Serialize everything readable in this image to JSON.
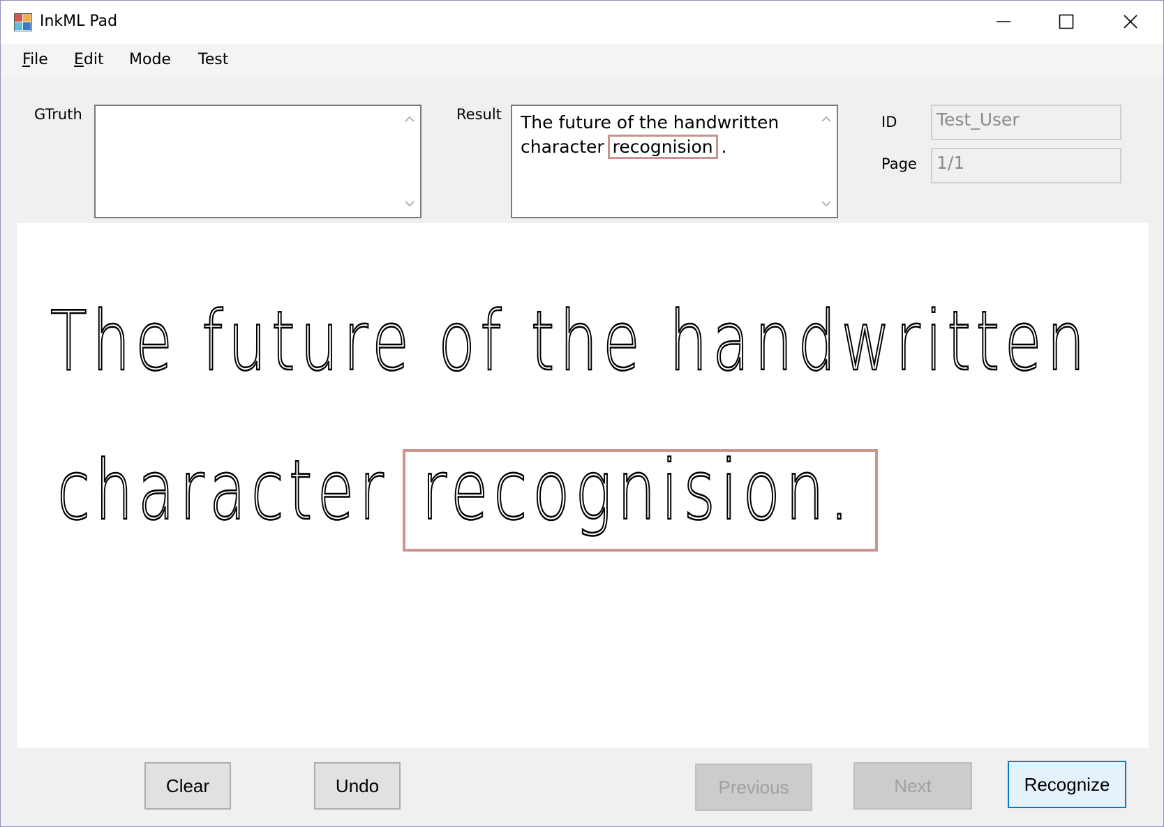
{
  "window": {
    "title": "InkML Pad",
    "controls": {
      "minimize_icon": "minimize-icon",
      "maximize_icon": "maximize-icon",
      "close_icon": "close-icon"
    }
  },
  "menu": {
    "items": [
      {
        "label": "File",
        "mnemonic": "F",
        "rest": "ile"
      },
      {
        "label": "Edit",
        "mnemonic": "E",
        "rest": "dit"
      },
      {
        "label": "Mode"
      },
      {
        "label": "Test"
      }
    ]
  },
  "fields": {
    "gtruth_label": "GTruth",
    "gtruth_value": "",
    "result_label": "Result",
    "result_prefix": "The future of the handwritten character ",
    "result_highlight": "recognision",
    "result_suffix": " .",
    "id_label": "ID",
    "id_value": "Test_User",
    "page_label": "Page",
    "page_value": "1/1"
  },
  "ink": {
    "line1": "The future of the handwritten",
    "line2_prefix": "character",
    "line2_highlight": "recognision."
  },
  "buttons": {
    "clear": "Clear",
    "undo": "Undo",
    "previous": "Previous",
    "next": "Next",
    "recognize": "Recognize"
  },
  "colors": {
    "highlight": "#c9938c",
    "primary_border": "#0078d7"
  }
}
